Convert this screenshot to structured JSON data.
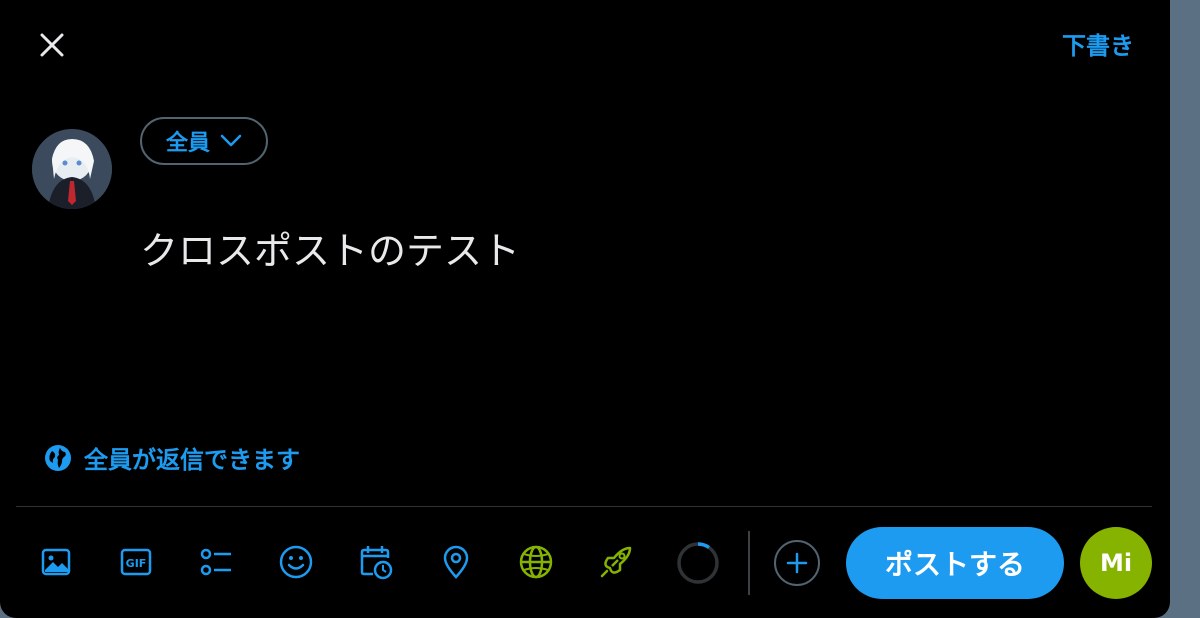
{
  "header": {
    "drafts_label": "下書き"
  },
  "audience": {
    "label": "全員"
  },
  "compose": {
    "text": "クロスポストのテスト"
  },
  "reply_settings": {
    "label": "全員が返信できます"
  },
  "toolbar": {
    "icons": [
      "media-icon",
      "gif-icon",
      "poll-icon",
      "emoji-icon",
      "schedule-icon",
      "location-icon",
      "globe-icon",
      "rocket-icon"
    ],
    "gif_text": "GIF"
  },
  "actions": {
    "post_label": "ポストする",
    "mi_label": "Mi"
  },
  "colors": {
    "accent": "#1d9bf0",
    "misskey": "#86b300",
    "background": "#000000",
    "text": "#e7e9ea"
  }
}
